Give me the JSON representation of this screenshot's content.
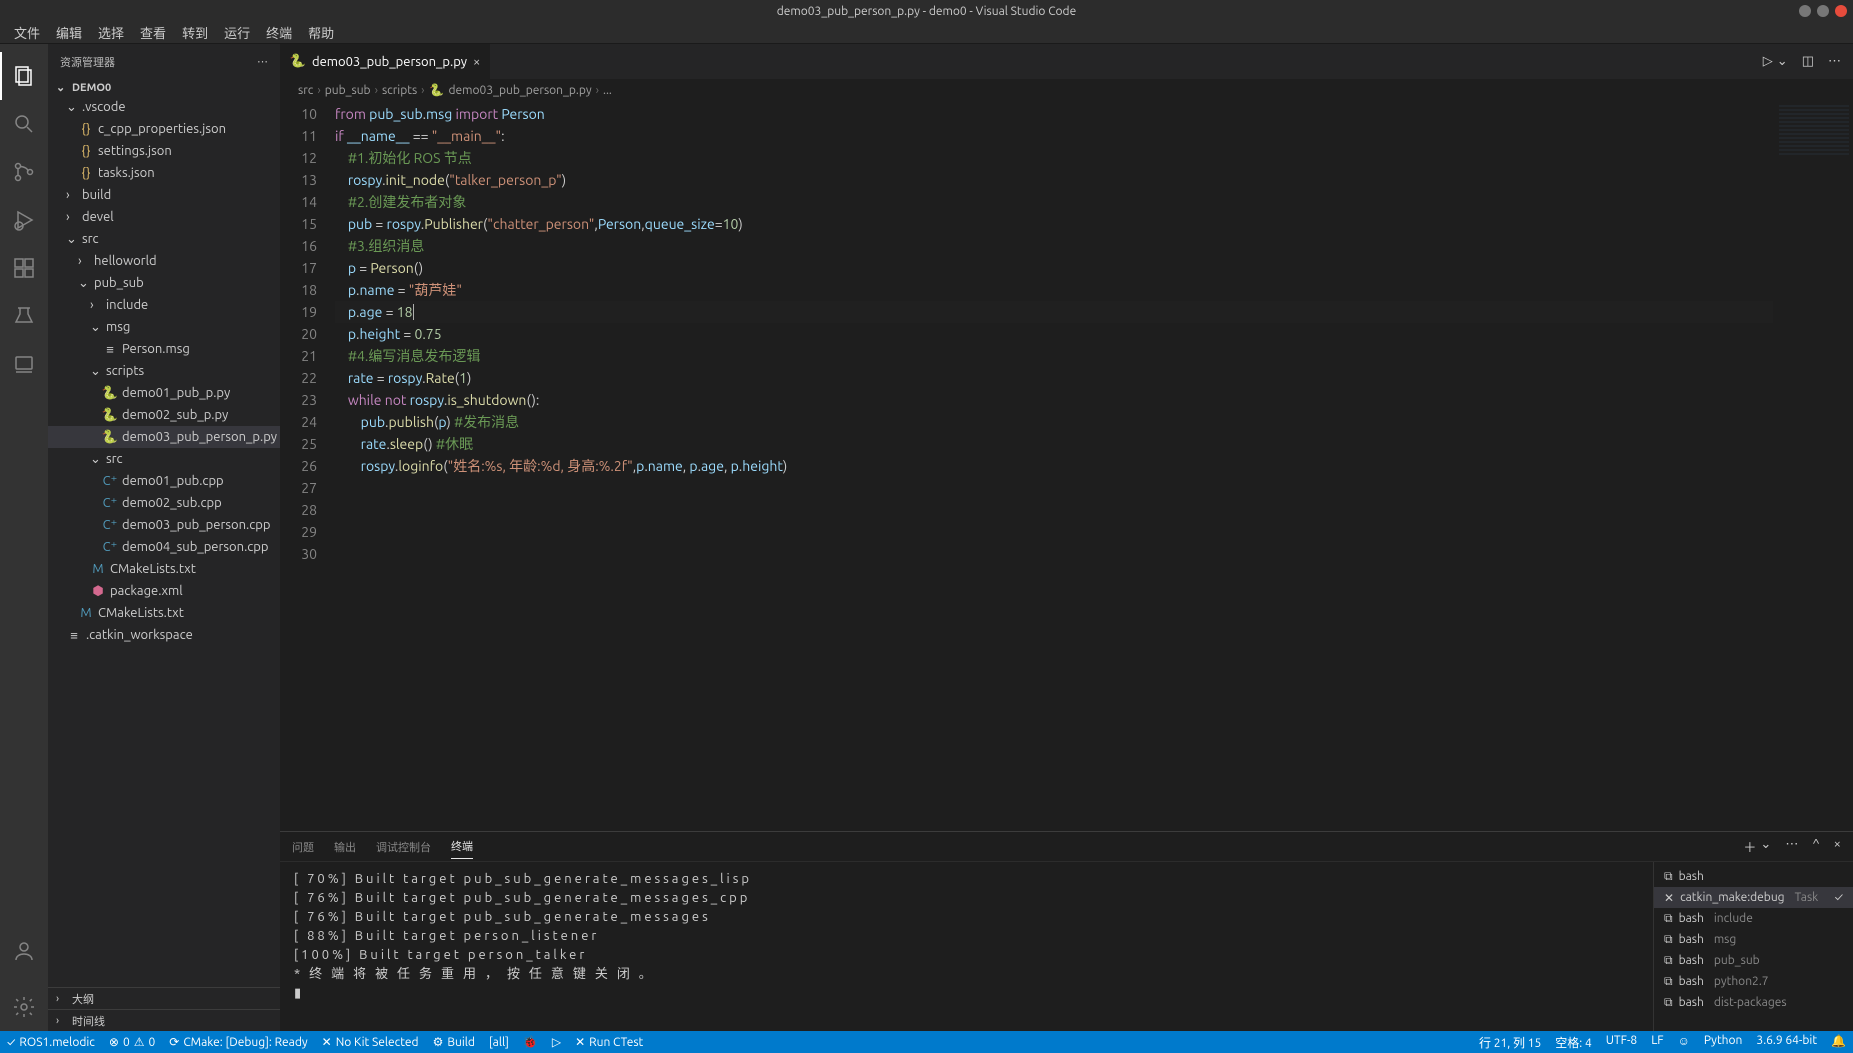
{
  "title": "demo03_pub_person_p.py - demo0 - Visual Studio Code",
  "menu": [
    "文件",
    "编辑",
    "选择",
    "查看",
    "转到",
    "运行",
    "终端",
    "帮助"
  ],
  "sidebar": {
    "header": "资源管理器",
    "root": "DEMO0",
    "outline": "大纲",
    "timeline": "时间线"
  },
  "tree": {
    "vscode": ".vscode",
    "ccpp": "c_cpp_properties.json",
    "settings": "settings.json",
    "tasks": "tasks.json",
    "build": "build",
    "devel": "devel",
    "src": "src",
    "helloworld": "helloworld",
    "pubsub": "pub_sub",
    "include": "include",
    "msg": "msg",
    "personmsg": "Person.msg",
    "scripts": "scripts",
    "demo01py": "demo01_pub_p.py",
    "demo02py": "demo02_sub_p.py",
    "demo03py": "demo03_pub_person_p.py",
    "srcinner": "src",
    "demo01cpp": "demo01_pub.cpp",
    "demo02cpp": "demo02_sub.cpp",
    "demo03cpp": "demo03_pub_person.cpp",
    "demo04cpp": "demo04_sub_person.cpp",
    "cmake1": "CMakeLists.txt",
    "pkg": "package.xml",
    "cmake2": "CMakeLists.txt",
    "catkinws": ".catkin_workspace"
  },
  "tab": {
    "name": "demo03_pub_person_p.py"
  },
  "breadcrumb": {
    "p1": "src",
    "p2": "pub_sub",
    "p3": "scripts",
    "p4": "demo03_pub_person_p.py",
    "p5": "..."
  },
  "code_lines": [
    10,
    11,
    12,
    13,
    14,
    15,
    16,
    17,
    18,
    19,
    20,
    21,
    22,
    23,
    24,
    25,
    26,
    27,
    28,
    29,
    30
  ],
  "panel": {
    "tabs": [
      "问题",
      "输出",
      "调试控制台",
      "终端"
    ],
    "active": 3,
    "terminal_lines": [
      "[  70%]  Built  target  pub_sub_generate_messages_lisp",
      "[  76%]  Built  target  pub_sub_generate_messages_cpp",
      "[  76%]  Built  target  pub_sub_generate_messages",
      "[  88%]  Built  target  person_listener",
      "[100%]  Built  target  person_talker",
      "  *    终  端  将  被  任  务  重  用  ，  按  任  意  键  关  闭  。",
      "▮"
    ],
    "term_list": [
      {
        "icon": "bash",
        "label": "bash",
        "sub": ""
      },
      {
        "icon": "task",
        "label": "catkin_make:debug",
        "sub": "Task",
        "active": true
      },
      {
        "icon": "bash",
        "label": "bash",
        "sub": "include"
      },
      {
        "icon": "bash",
        "label": "bash",
        "sub": "msg"
      },
      {
        "icon": "bash",
        "label": "bash",
        "sub": "pub_sub"
      },
      {
        "icon": "bash",
        "label": "bash",
        "sub": "python2.7"
      },
      {
        "icon": "bash",
        "label": "bash",
        "sub": "dist-packages"
      }
    ]
  },
  "status": {
    "ros": "ROS1.melodic",
    "errwarn": "0",
    "errwarn2": "0",
    "cmake": "CMake: [Debug]: Ready",
    "kit": "No Kit Selected",
    "build": "Build",
    "target": "[all]",
    "ctest": "Run CTest",
    "pos": "行 21,  列 15",
    "spaces": "空格: 4",
    "enc": "UTF-8",
    "eol": "LF",
    "lang": "Python",
    "pyver": "3.6.9 64-bit"
  }
}
